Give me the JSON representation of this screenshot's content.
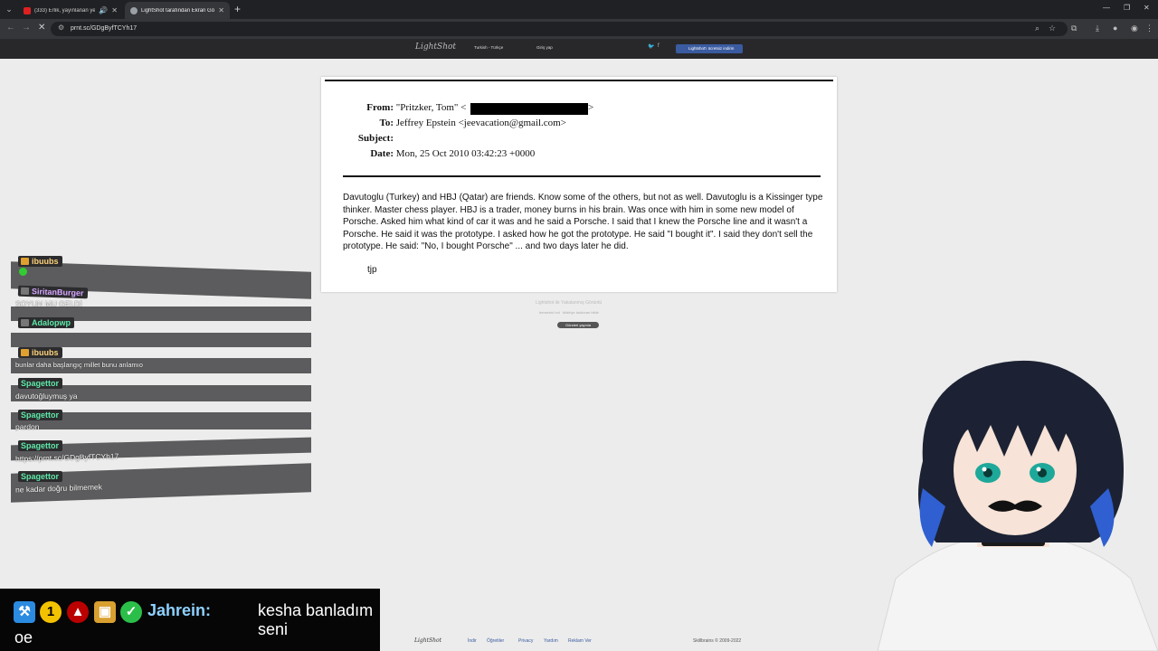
{
  "browser": {
    "tabs": [
      {
        "title": "(333) Erlik, yayınlanan yeni bir ...",
        "active": false
      },
      {
        "title": "LightShot tarafından Ekran Görüntüsü",
        "active": true
      }
    ],
    "url": "prnt.sc/GDgByfTCYh17"
  },
  "lightshot": {
    "logo": "LightShot",
    "language": "Turkish - Türkçe",
    "login": "Giriş yap",
    "download_label": "Lightshot'ı ücretsiz indirin",
    "caption": "Lightshot ile Yakalanmış Görüntü",
    "sub_links": [
      "benzerini bul",
      "bildiriye bulduran bildir"
    ],
    "tweet_label": "Gönderi yayınla"
  },
  "email": {
    "from_label": "From:",
    "from_value": "\"Pritzker, Tom\" <",
    "from_end": ">",
    "to_label": "To:",
    "to_value": "Jeffrey Epstein <jeevacation@gmail.com>",
    "subject_label": "Subject:",
    "subject_value": "",
    "date_label": "Date:",
    "date_value": "Mon, 25 Oct 2010 03:42:23 +0000",
    "body": "Davutoglu (Turkey) and HBJ (Qatar) are friends.  Know some of the others, but not as well.  Davutoglu is a Kissinger type thinker.  Master chess player.  HBJ is a trader, money burns in his brain.  Was once with him in some new model of Porsche.  Asked him what kind of car it was and he said a Porsche.  I said that I knew the Porsche line and it wasn't a Porsche.  He said it was the prototype.  I asked how he got the prototype.  He said \"I bought it\".  I said they don't sell the prototype.  He said:  \"No, I bought Porsche\" ... and two days later he did.",
    "signature": "tjp"
  },
  "chat_overlay": [
    {
      "user": "ibuubs",
      "text": "",
      "color": "gold"
    },
    {
      "user": "SiritanBurger",
      "text": "SOYUN MU GELDİ",
      "color": "purple"
    },
    {
      "user": "Adalopwp",
      "text": "",
      "color": "green"
    },
    {
      "user": "ibuubs",
      "text": "bunlar daha başlangıç millet bunu anlamıo",
      "color": "gold"
    },
    {
      "user": "Spagettor",
      "text": "davutoğluymuş ya",
      "color": "green"
    },
    {
      "user": "Spagettor",
      "text": "pardon",
      "color": "green"
    },
    {
      "user": "Spagettor",
      "text": "https://prnt.sc/GDgByfTCYh17",
      "color": "green"
    },
    {
      "user": "Spagettor",
      "text": "ne kadar doğru bilmemek",
      "color": "green"
    }
  ],
  "stream_chat": {
    "user": "Jahrein:",
    "message": "kesha banladım seni",
    "message_cont": "oe",
    "badge_number": "1"
  },
  "footer": {
    "logo": "LightShot",
    "links": [
      "İndir",
      "Öğretiler",
      "Privacy",
      "Yardım",
      "Reklam Ver"
    ],
    "copyright": "Skillbrains © 2009-2022"
  }
}
